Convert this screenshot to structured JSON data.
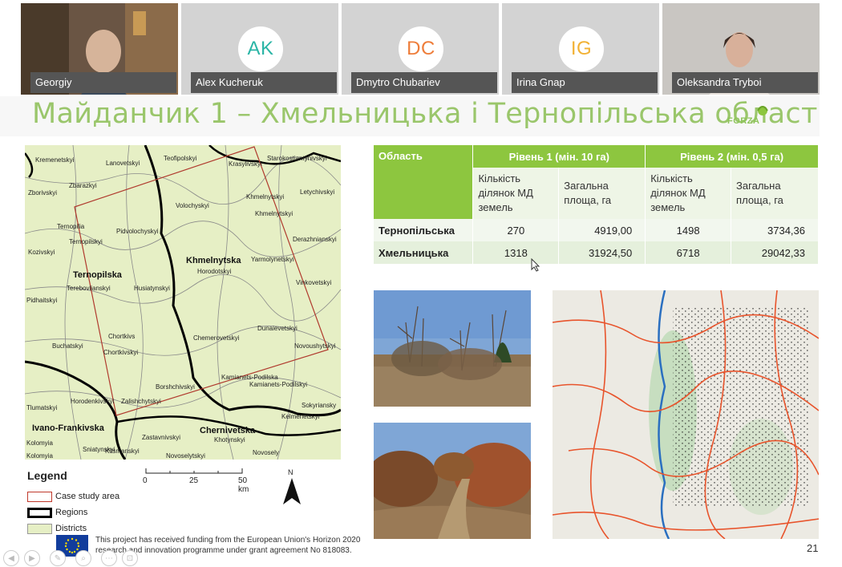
{
  "participants": [
    {
      "name": "Georgiy",
      "type": "video"
    },
    {
      "name": "Alex Kucheruk",
      "initials": "AK",
      "initials_color": "#2bb5a6"
    },
    {
      "name": "Dmytro Chubariev",
      "initials": "DC",
      "initials_color": "#ee7d3a"
    },
    {
      "name": "Irina Gnap",
      "initials": "IG",
      "initials_color": "#f2b134"
    },
    {
      "name": "Oleksandra Tryboi",
      "type": "video"
    }
  ],
  "slide": {
    "title": "Майданчик 1 – Хмельницька і Тернопільська області",
    "logo_text": "FORZA",
    "page_number": "21",
    "footer": "This project has received funding from the European Union's Horizon 2020 research and innovation programme under grant agreement No 818083.",
    "accent_color": "#8dc63f"
  },
  "map": {
    "regions": [
      "Ternopilska",
      "Khmelnytska",
      "Ivano-Frankivska",
      "Chernivetska"
    ],
    "districts": [
      "Kremenetskyi",
      "Lanovetskyi",
      "Teofipolskyi",
      "Krasylivskyi",
      "Starokostiantynivskyi",
      "Zborivskyi",
      "Zbarazkyi",
      "Letychivskyi",
      "Khmelnytskyi",
      "Volochyskyi",
      "Khmelnytskyi",
      "Ternopilia",
      "Ternopilskyi",
      "Pidvolochyskyi",
      "Derazhnianskyi",
      "Kozivskyi",
      "Yarmolynetskyi",
      "Horodotskyi",
      "Terebovlianskyi",
      "Vinkovetskyi",
      "Husiatynskyi",
      "Pidhaitskyi",
      "Dunaievetskyi",
      "Chortkivs",
      "Chemerovetskyi",
      "Buchatskyi",
      "Chortkivskyi",
      "Novoushytskyi",
      "Kamianets-Podilska",
      "Borshchivskyi",
      "Kamianets-Podilskyi",
      "Zalishchytskyi",
      "Sokyriansky",
      "Tlumatskyi",
      "Horodenkivskyi",
      "Kelmenetskyi",
      "Zastavnivskyi",
      "Khotynskyi",
      "Kolomyia",
      "Sniatynskyi",
      "Kitsmanskyi",
      "Novoselytskyi",
      "Kolomyia",
      "Novosely"
    ],
    "legend_title": "Legend",
    "legend": [
      {
        "label": "Case study area",
        "color": "#c0392b"
      },
      {
        "label": "Regions",
        "color": "#000000"
      },
      {
        "label": "Districts",
        "color": "#e6efc5"
      }
    ],
    "scale_labels": [
      "0",
      "25",
      "50 km"
    ],
    "north_label": "N"
  },
  "table": {
    "header": {
      "oblast": "Область",
      "level1": "Рівень 1 (мін. 10 га)",
      "level2": "Рівень 2 (мін. 0,5 га)"
    },
    "subheaders": [
      "Кількість ділянок МД земель",
      "Загальна площа, га",
      "Кількість ділянок МД земель",
      "Загальна площа, га"
    ],
    "rows": [
      {
        "name": "Тернопільська",
        "values": [
          "270",
          "4919,00",
          "1498",
          "3734,36"
        ]
      },
      {
        "name": "Хмельницька",
        "values": [
          "1318",
          "31924,50",
          "6718",
          "29042,33"
        ]
      }
    ]
  }
}
